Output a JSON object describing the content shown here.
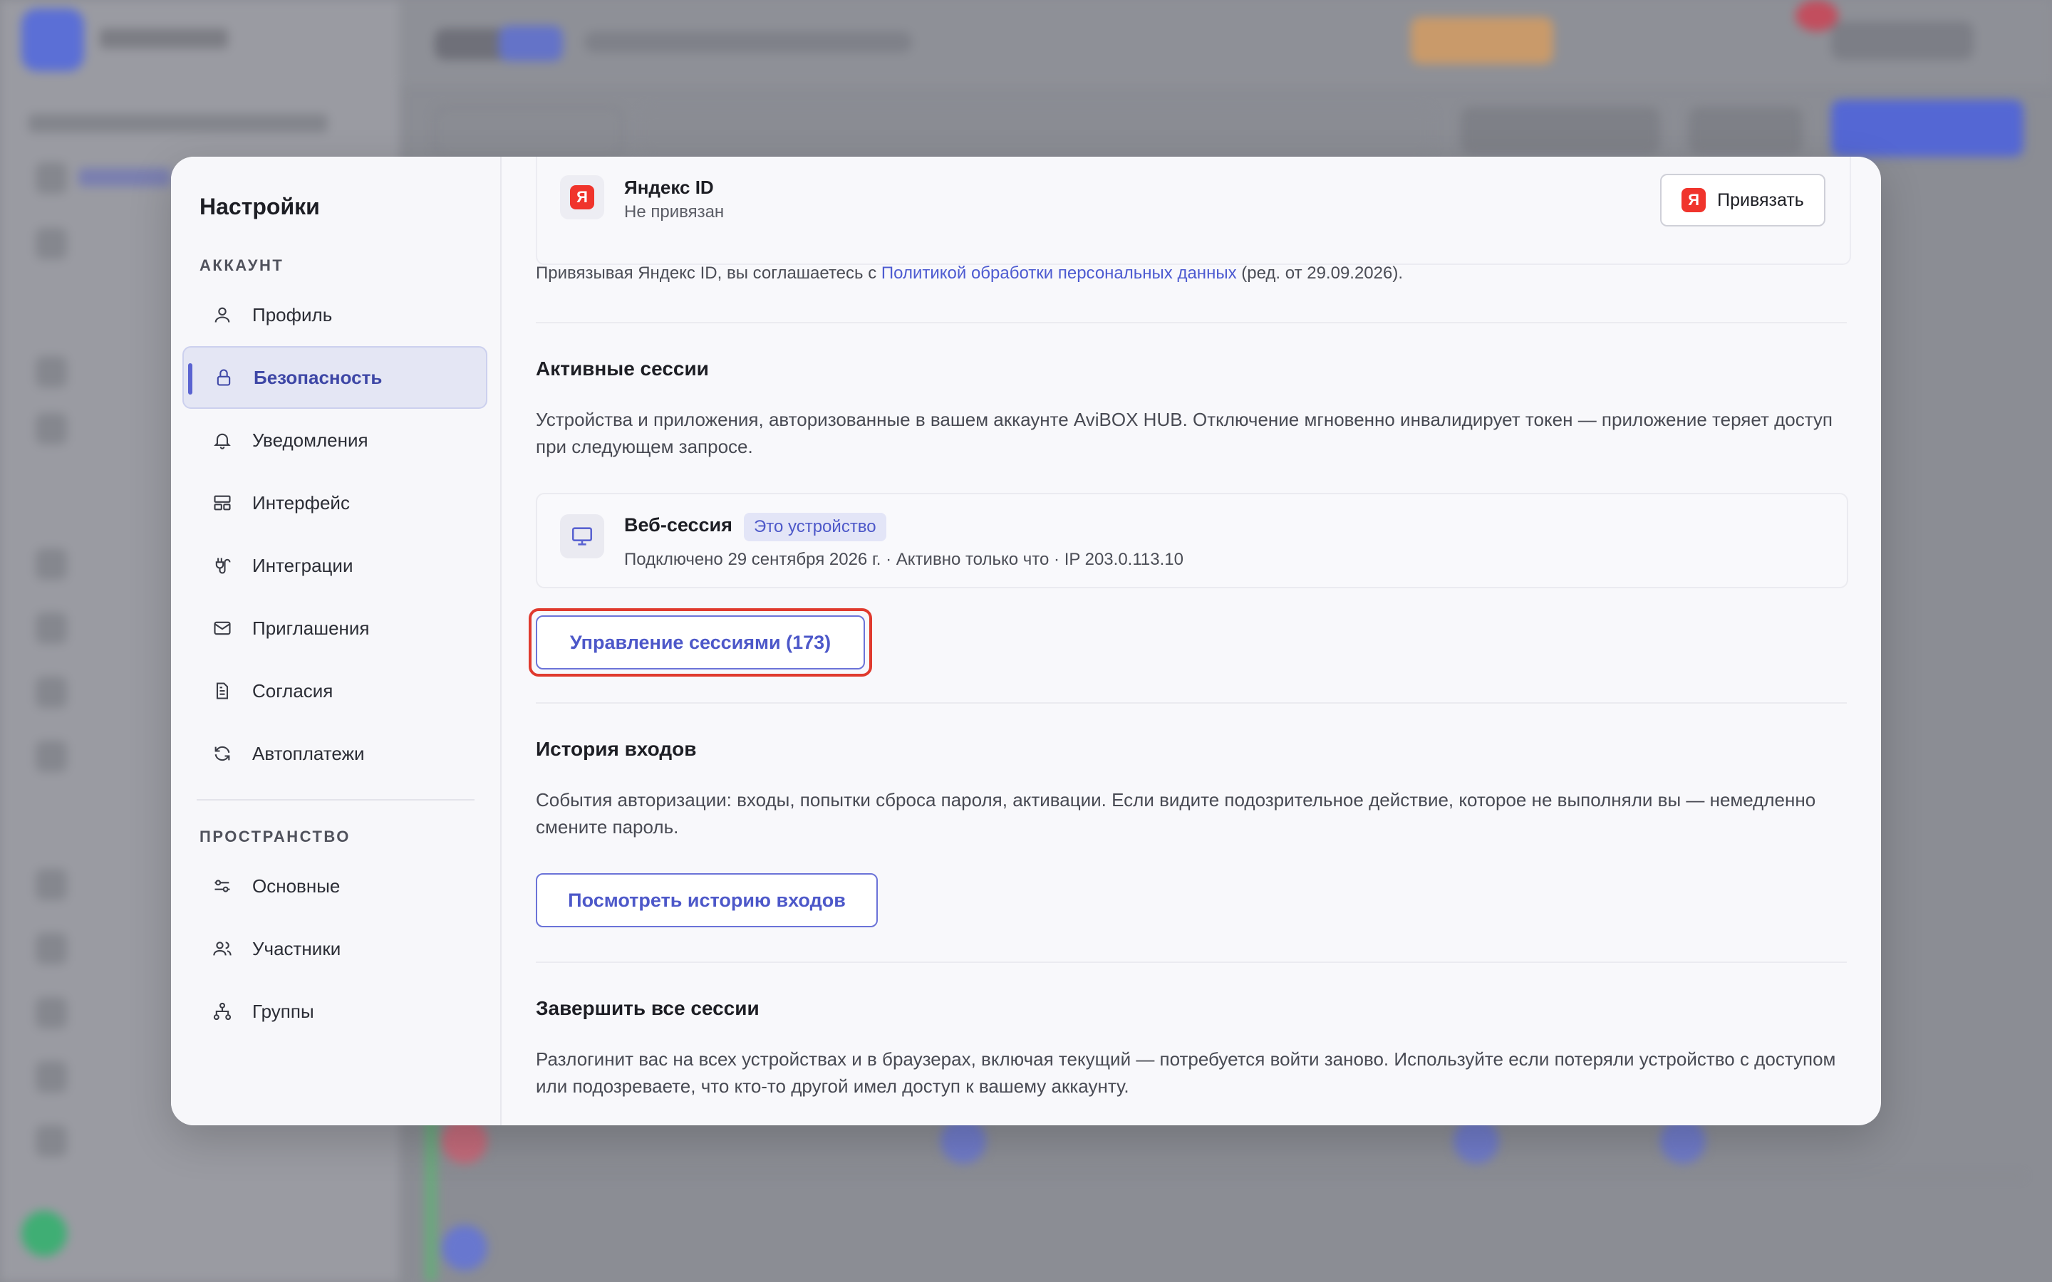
{
  "settings": {
    "title": "Настройки",
    "account_section": "АККАУНТ",
    "account_items": [
      {
        "label": "Профиль",
        "icon": "user-icon"
      },
      {
        "label": "Безопасность",
        "icon": "lock-icon",
        "active": true
      },
      {
        "label": "Уведомления",
        "icon": "bell-icon"
      },
      {
        "label": "Интерфейс",
        "icon": "layout-icon"
      },
      {
        "label": "Интеграции",
        "icon": "plug-icon"
      },
      {
        "label": "Приглашения",
        "icon": "mail-icon"
      },
      {
        "label": "Согласия",
        "icon": "document-icon"
      },
      {
        "label": "Автоплатежи",
        "icon": "refresh-icon"
      }
    ],
    "space_section": "ПРОСТРАНСТВО",
    "space_items": [
      {
        "label": "Основные",
        "icon": "sliders-icon"
      },
      {
        "label": "Участники",
        "icon": "users-icon"
      },
      {
        "label": "Группы",
        "icon": "hierarchy-icon"
      }
    ]
  },
  "yandex": {
    "badge": "Я",
    "title": "Яндекс ID",
    "status": "Не привязан",
    "bind_label": "Привязать",
    "consent_prefix": "Привязывая Яндекс ID, вы соглашаетесь с",
    "consent_link": "Политикой обработки персональных данных",
    "consent_suffix": "(ред. от 29.09.2026)."
  },
  "sessions": {
    "heading": "Активные сессии",
    "description": "Устройства и приложения, авторизованные в вашем аккаунте AviBOX HUB. Отключение мгновенно инвалидирует токен — приложение теряет доступ при следующем запросе.",
    "current": {
      "title": "Веб-сессия",
      "badge": "Это устройство",
      "meta": "Подключено 29 сентября 2026 г.  ·  Активно только что  ·  IP 203.0.113.10"
    },
    "manage_label": "Управление сессиями (173)"
  },
  "history": {
    "heading": "История входов",
    "description": "События авторизации: входы, попытки сброса пароля, активации. Если видите подозрительное действие, которое не выполняли вы — немедленно смените пароль.",
    "button_label": "Посмотреть историю входов"
  },
  "terminate": {
    "heading": "Завершить все сессии",
    "description": "Разлогинит вас на всех устройствах и в браузерах, включая текущий — потребуется войти заново. Используйте если потеряли устройство с доступом или подозреваете, что кто-то другой имел доступ к вашему аккаунту."
  },
  "colors": {
    "accent": "#5a63d1",
    "highlight": "#e03a2e",
    "yandex": "#f0342c"
  }
}
